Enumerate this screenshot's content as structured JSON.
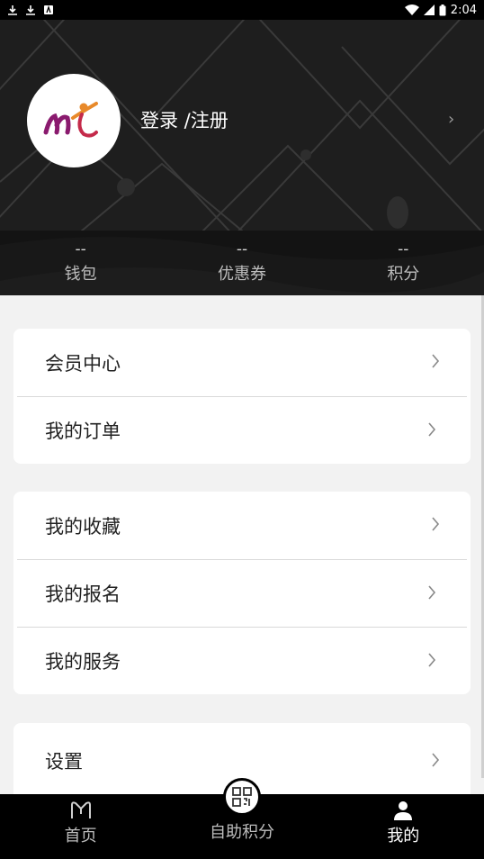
{
  "status_bar": {
    "time": "2:04"
  },
  "profile": {
    "login_label": "登录 /注册"
  },
  "stats": [
    {
      "value": "--",
      "label": "钱包"
    },
    {
      "value": "--",
      "label": "优惠券"
    },
    {
      "value": "--",
      "label": "积分"
    }
  ],
  "menu": {
    "group1": [
      "会员中心",
      "我的订单"
    ],
    "group2": [
      "我的收藏",
      "我的报名",
      "我的服务"
    ],
    "group3": [
      "设置"
    ]
  },
  "tabbar": {
    "home": "首页",
    "points": "自助积分",
    "mine": "我的"
  },
  "colors": {
    "header_bg": "#1e1e1e",
    "page_bg": "#f2f2f2",
    "logo_magenta": "#a0196a",
    "logo_orange": "#e8892a"
  }
}
